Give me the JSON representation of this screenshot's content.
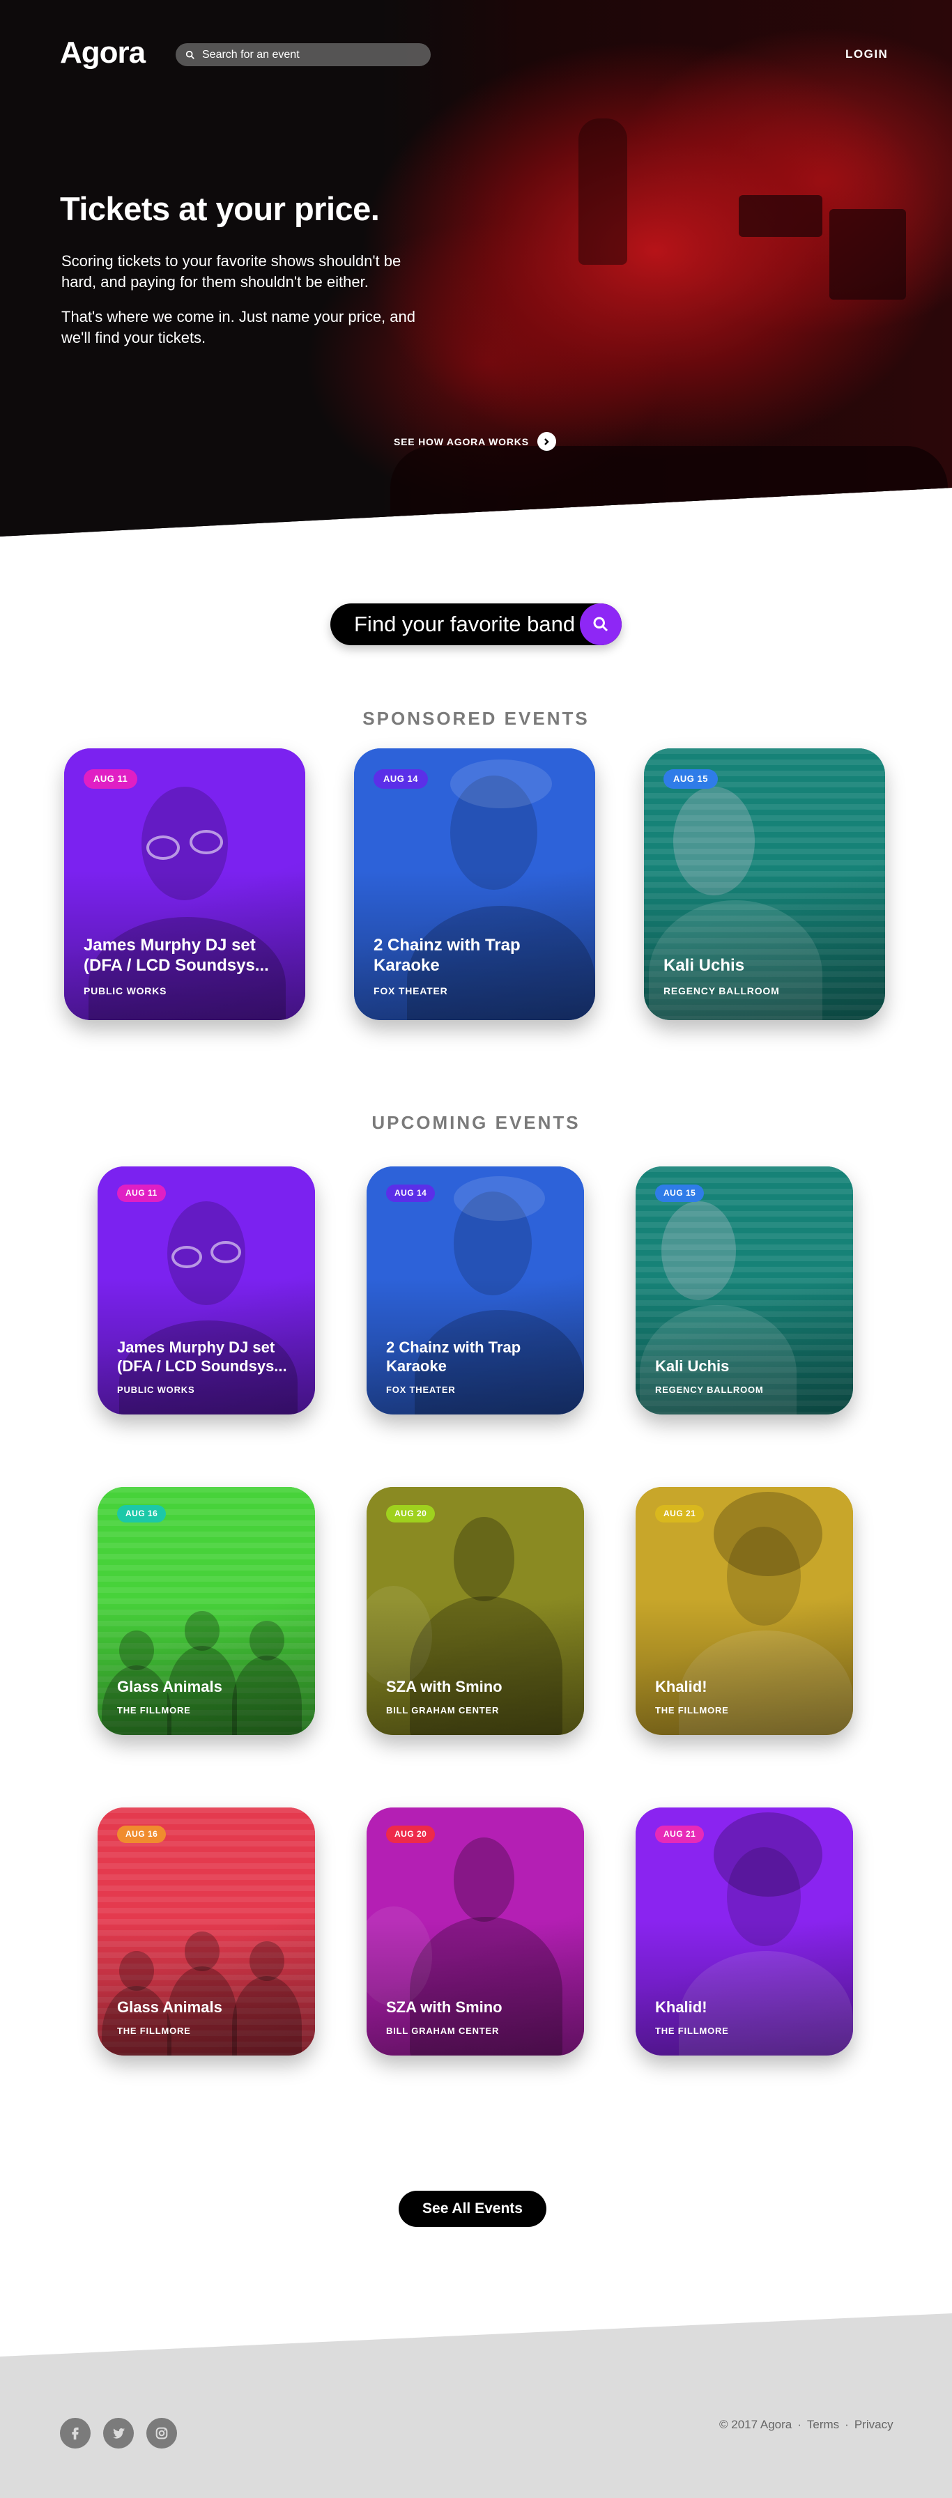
{
  "header": {
    "logo": "Agora",
    "search_placeholder": "Search for an event",
    "login_label": "LOGIN"
  },
  "hero": {
    "title": "Tickets at your price.",
    "paragraph_1": "Scoring tickets to your favorite shows shouldn't be hard, and paying for them shouldn't be either.",
    "paragraph_2": "That's where we come in. Just name your price, and we'll find your tickets.",
    "how_link": "SEE HOW AGORA WORKS"
  },
  "band_search": {
    "placeholder": "Find your favorite band"
  },
  "sponsored": {
    "title": "SPONSORED EVENTS",
    "cards": [
      {
        "date": "AUG 11",
        "name": "James Murphy DJ set (DFA / LCD Soundsys...",
        "venue": "PUBLIC WORKS",
        "tint": "#7b22f0",
        "badge_color": "#e01fc4"
      },
      {
        "date": "AUG 14",
        "name": "2 Chainz with Trap Karaoke",
        "venue": "FOX THEATER",
        "tint": "#2d62d9",
        "badge_color": "#5b2fe8"
      },
      {
        "date": "AUG 15",
        "name": "Kali Uchis",
        "venue": "REGENCY BALLROOM",
        "tint": "#168277",
        "badge_color": "#2f7ce8"
      }
    ]
  },
  "upcoming": {
    "title": "UPCOMING EVENTS",
    "cards": [
      {
        "date": "AUG 11",
        "name": "James Murphy DJ set (DFA / LCD Soundsys...",
        "venue": "PUBLIC WORKS",
        "tint": "#7b22f0",
        "badge_color": "#e01fc4"
      },
      {
        "date": "AUG 14",
        "name": "2 Chainz with Trap Karaoke",
        "venue": "FOX THEATER",
        "tint": "#2d62d9",
        "badge_color": "#5b2fe8"
      },
      {
        "date": "AUG 15",
        "name": "Kali Uchis",
        "venue": "REGENCY BALLROOM",
        "tint": "#168277",
        "badge_color": "#2f7ce8"
      },
      {
        "date": "AUG 16",
        "name": "Glass Animals",
        "venue": "THE FILLMORE",
        "tint": "#47d23a",
        "badge_color": "#1cc8a8"
      },
      {
        "date": "AUG 20",
        "name": "SZA with Smino",
        "venue": "BILL GRAHAM CENTER",
        "tint": "#8a8a22",
        "badge_color": "#9fd11e"
      },
      {
        "date": "AUG 21",
        "name": "Khalid!",
        "venue": "THE FILLMORE",
        "tint": "#c8a62a",
        "badge_color": "#d9b81e"
      },
      {
        "date": "AUG 16",
        "name": "Glass Animals",
        "venue": "THE FILLMORE",
        "tint": "#e43a4e",
        "badge_color": "#f08c2e"
      },
      {
        "date": "AUG 20",
        "name": "SZA with Smino",
        "venue": "BILL GRAHAM CENTER",
        "tint": "#b41fb4",
        "badge_color": "#ee2a4a"
      },
      {
        "date": "AUG 21",
        "name": "Khalid!",
        "venue": "THE FILLMORE",
        "tint": "#8a24f0",
        "badge_color": "#e72ab8"
      }
    ]
  },
  "see_all_label": "See All Events",
  "footer": {
    "social": [
      "facebook-icon",
      "twitter-icon",
      "instagram-icon"
    ],
    "copyright": "© 2017 Agora",
    "terms": "Terms",
    "privacy": "Privacy",
    "separator": "·"
  }
}
